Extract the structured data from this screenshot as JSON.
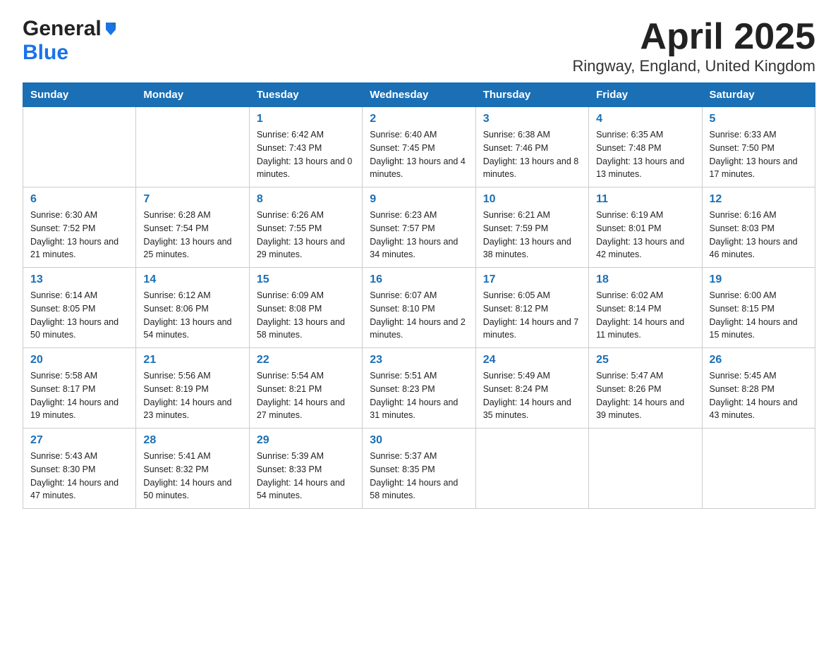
{
  "logo": {
    "general": "General",
    "blue": "Blue"
  },
  "title": "April 2025",
  "subtitle": "Ringway, England, United Kingdom",
  "days_of_week": [
    "Sunday",
    "Monday",
    "Tuesday",
    "Wednesday",
    "Thursday",
    "Friday",
    "Saturday"
  ],
  "weeks": [
    [
      {
        "day": "",
        "info": ""
      },
      {
        "day": "",
        "info": ""
      },
      {
        "day": "1",
        "sunrise": "6:42 AM",
        "sunset": "7:43 PM",
        "daylight": "13 hours and 0 minutes."
      },
      {
        "day": "2",
        "sunrise": "6:40 AM",
        "sunset": "7:45 PM",
        "daylight": "13 hours and 4 minutes."
      },
      {
        "day": "3",
        "sunrise": "6:38 AM",
        "sunset": "7:46 PM",
        "daylight": "13 hours and 8 minutes."
      },
      {
        "day": "4",
        "sunrise": "6:35 AM",
        "sunset": "7:48 PM",
        "daylight": "13 hours and 13 minutes."
      },
      {
        "day": "5",
        "sunrise": "6:33 AM",
        "sunset": "7:50 PM",
        "daylight": "13 hours and 17 minutes."
      }
    ],
    [
      {
        "day": "6",
        "sunrise": "6:30 AM",
        "sunset": "7:52 PM",
        "daylight": "13 hours and 21 minutes."
      },
      {
        "day": "7",
        "sunrise": "6:28 AM",
        "sunset": "7:54 PM",
        "daylight": "13 hours and 25 minutes."
      },
      {
        "day": "8",
        "sunrise": "6:26 AM",
        "sunset": "7:55 PM",
        "daylight": "13 hours and 29 minutes."
      },
      {
        "day": "9",
        "sunrise": "6:23 AM",
        "sunset": "7:57 PM",
        "daylight": "13 hours and 34 minutes."
      },
      {
        "day": "10",
        "sunrise": "6:21 AM",
        "sunset": "7:59 PM",
        "daylight": "13 hours and 38 minutes."
      },
      {
        "day": "11",
        "sunrise": "6:19 AM",
        "sunset": "8:01 PM",
        "daylight": "13 hours and 42 minutes."
      },
      {
        "day": "12",
        "sunrise": "6:16 AM",
        "sunset": "8:03 PM",
        "daylight": "13 hours and 46 minutes."
      }
    ],
    [
      {
        "day": "13",
        "sunrise": "6:14 AM",
        "sunset": "8:05 PM",
        "daylight": "13 hours and 50 minutes."
      },
      {
        "day": "14",
        "sunrise": "6:12 AM",
        "sunset": "8:06 PM",
        "daylight": "13 hours and 54 minutes."
      },
      {
        "day": "15",
        "sunrise": "6:09 AM",
        "sunset": "8:08 PM",
        "daylight": "13 hours and 58 minutes."
      },
      {
        "day": "16",
        "sunrise": "6:07 AM",
        "sunset": "8:10 PM",
        "daylight": "14 hours and 2 minutes."
      },
      {
        "day": "17",
        "sunrise": "6:05 AM",
        "sunset": "8:12 PM",
        "daylight": "14 hours and 7 minutes."
      },
      {
        "day": "18",
        "sunrise": "6:02 AM",
        "sunset": "8:14 PM",
        "daylight": "14 hours and 11 minutes."
      },
      {
        "day": "19",
        "sunrise": "6:00 AM",
        "sunset": "8:15 PM",
        "daylight": "14 hours and 15 minutes."
      }
    ],
    [
      {
        "day": "20",
        "sunrise": "5:58 AM",
        "sunset": "8:17 PM",
        "daylight": "14 hours and 19 minutes."
      },
      {
        "day": "21",
        "sunrise": "5:56 AM",
        "sunset": "8:19 PM",
        "daylight": "14 hours and 23 minutes."
      },
      {
        "day": "22",
        "sunrise": "5:54 AM",
        "sunset": "8:21 PM",
        "daylight": "14 hours and 27 minutes."
      },
      {
        "day": "23",
        "sunrise": "5:51 AM",
        "sunset": "8:23 PM",
        "daylight": "14 hours and 31 minutes."
      },
      {
        "day": "24",
        "sunrise": "5:49 AM",
        "sunset": "8:24 PM",
        "daylight": "14 hours and 35 minutes."
      },
      {
        "day": "25",
        "sunrise": "5:47 AM",
        "sunset": "8:26 PM",
        "daylight": "14 hours and 39 minutes."
      },
      {
        "day": "26",
        "sunrise": "5:45 AM",
        "sunset": "8:28 PM",
        "daylight": "14 hours and 43 minutes."
      }
    ],
    [
      {
        "day": "27",
        "sunrise": "5:43 AM",
        "sunset": "8:30 PM",
        "daylight": "14 hours and 47 minutes."
      },
      {
        "day": "28",
        "sunrise": "5:41 AM",
        "sunset": "8:32 PM",
        "daylight": "14 hours and 50 minutes."
      },
      {
        "day": "29",
        "sunrise": "5:39 AM",
        "sunset": "8:33 PM",
        "daylight": "14 hours and 54 minutes."
      },
      {
        "day": "30",
        "sunrise": "5:37 AM",
        "sunset": "8:35 PM",
        "daylight": "14 hours and 58 minutes."
      },
      {
        "day": "",
        "info": ""
      },
      {
        "day": "",
        "info": ""
      },
      {
        "day": "",
        "info": ""
      }
    ]
  ]
}
